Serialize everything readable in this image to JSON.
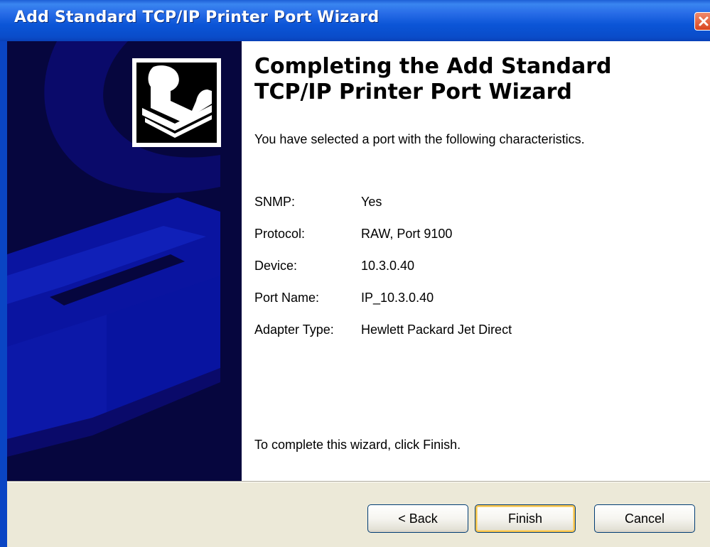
{
  "window": {
    "title": "Add Standard TCP/IP Printer Port Wizard",
    "close_icon": "close-icon"
  },
  "banner": {
    "icon": "printer-port-icon"
  },
  "content": {
    "heading": "Completing the Add Standard TCP/IP Printer Port Wizard",
    "intro": "You have selected a port with the following characteristics.",
    "details": [
      {
        "label": "SNMP:",
        "value": "Yes"
      },
      {
        "label": "Protocol:",
        "value": "RAW, Port 9100"
      },
      {
        "label": "Device:",
        "value": "10.3.0.40"
      },
      {
        "label": "Port Name:",
        "value": "IP_10.3.0.40"
      },
      {
        "label": "Adapter Type:",
        "value": "Hewlett Packard Jet Direct"
      }
    ],
    "finish_note": "To complete this wizard, click Finish."
  },
  "buttons": {
    "back": "< Back",
    "finish": "Finish",
    "cancel": "Cancel"
  },
  "colors": {
    "titlebar": "#0a52d6",
    "banner_bg": "#06063e",
    "banner_shape": "#0a1aa0",
    "button_face": "#ece9d8",
    "close_button": "#e0562e"
  }
}
